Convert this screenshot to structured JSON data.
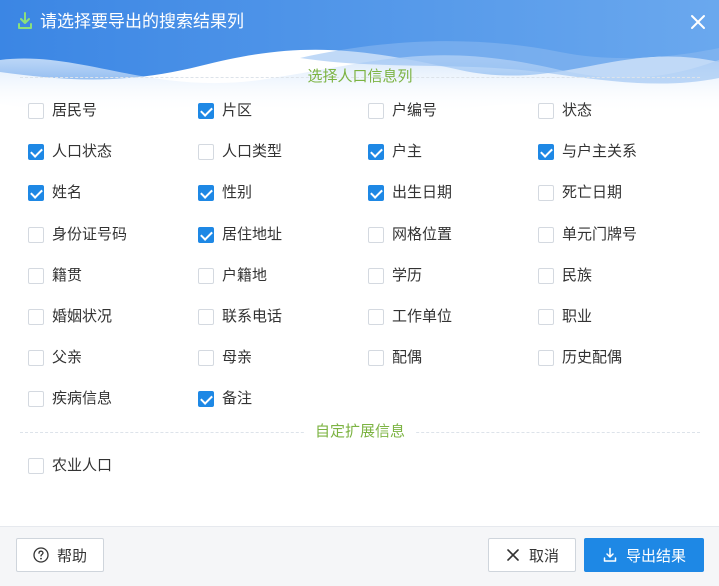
{
  "dialog": {
    "title": "请选择要导出的搜索结果列",
    "title_icon": "download-icon",
    "close_icon": "close-icon"
  },
  "sections": {
    "population": {
      "title": "选择人口信息列"
    },
    "extended": {
      "title": "自定扩展信息"
    }
  },
  "fields": [
    {
      "label": "居民号",
      "checked": false
    },
    {
      "label": "片区",
      "checked": true
    },
    {
      "label": "户编号",
      "checked": false
    },
    {
      "label": "状态",
      "checked": false
    },
    {
      "label": "人口状态",
      "checked": true
    },
    {
      "label": "人口类型",
      "checked": false
    },
    {
      "label": "户主",
      "checked": true
    },
    {
      "label": "与户主关系",
      "checked": true
    },
    {
      "label": "姓名",
      "checked": true
    },
    {
      "label": "性别",
      "checked": true
    },
    {
      "label": "出生日期",
      "checked": true
    },
    {
      "label": "死亡日期",
      "checked": false
    },
    {
      "label": "身份证号码",
      "checked": false
    },
    {
      "label": "居住地址",
      "checked": true
    },
    {
      "label": "网格位置",
      "checked": false
    },
    {
      "label": "单元门牌号",
      "checked": false
    },
    {
      "label": "籍贯",
      "checked": false
    },
    {
      "label": "户籍地",
      "checked": false
    },
    {
      "label": "学历",
      "checked": false
    },
    {
      "label": "民族",
      "checked": false
    },
    {
      "label": "婚姻状况",
      "checked": false
    },
    {
      "label": "联系电话",
      "checked": false
    },
    {
      "label": "工作单位",
      "checked": false
    },
    {
      "label": "职业",
      "checked": false
    },
    {
      "label": "父亲",
      "checked": false
    },
    {
      "label": "母亲",
      "checked": false
    },
    {
      "label": "配偶",
      "checked": false
    },
    {
      "label": "历史配偶",
      "checked": false
    },
    {
      "label": "疾病信息",
      "checked": false
    },
    {
      "label": "备注",
      "checked": true
    }
  ],
  "extended_fields": [
    {
      "label": "农业人口",
      "checked": false
    }
  ],
  "footer": {
    "help_label": "帮助",
    "help_icon": "help-circle-icon",
    "cancel_label": "取消",
    "cancel_icon": "close-icon",
    "export_label": "导出结果",
    "export_icon": "download-icon"
  },
  "colors": {
    "accent": "#1e88e5",
    "section_title": "#7cb342",
    "header_gradient_start": "#3b86e4",
    "header_gradient_end": "#a9cdf5"
  }
}
